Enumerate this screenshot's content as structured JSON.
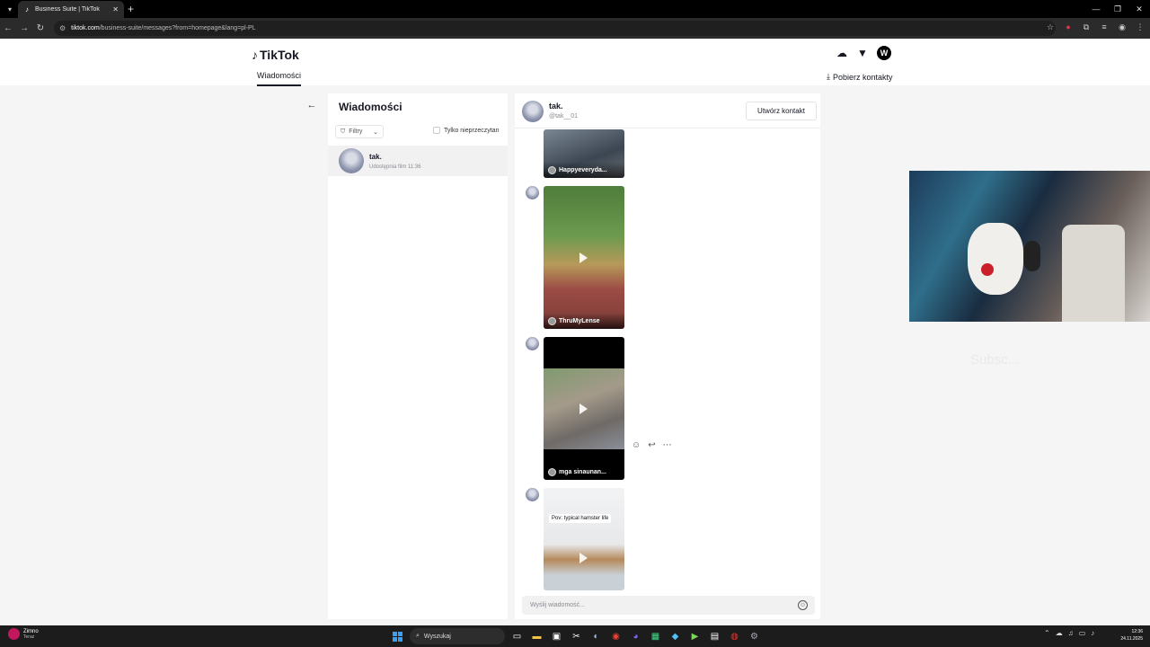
{
  "browser": {
    "tab_title": "Business Suite | TikTok",
    "new_tab_symbol": "+",
    "url_host": "tiktok.com",
    "url_path": "/business-suite/messages?from=homepage&lang=pl-PL"
  },
  "header": {
    "logo": "TikTok",
    "nav_tab": "Wiadomości",
    "avatar_letter": "W",
    "download_contacts": "Pobierz kontakty"
  },
  "inbox": {
    "title": "Wiadomości",
    "filters_label": "Filtry",
    "unread_only_label": "Tylko nieprzeczytan",
    "conversations": [
      {
        "name": "tak.",
        "preview": "Udostępnia film",
        "time": "11:36"
      }
    ]
  },
  "chat": {
    "name": "tak.",
    "handle": "@tak__01",
    "create_contact_label": "Utwórz kontakt",
    "videos": [
      {
        "author": "Happyeveryda..."
      },
      {
        "author": "ThruMyLense"
      },
      {
        "author": "mga sinaunan..."
      },
      {
        "overlay_text": "Pov: typical hamster life"
      }
    ],
    "input_placeholder": "Wyślij wiadomość..."
  },
  "overlay_text": "Subsc...",
  "taskbar": {
    "weather_title": "Zimno",
    "weather_sub": "Teraz",
    "search_label": "Wyszukaj",
    "time": "12:36",
    "date": "24.11.2025"
  },
  "colors": {
    "accent": "#161823",
    "tiktok_bg": "#f5f5f6"
  }
}
